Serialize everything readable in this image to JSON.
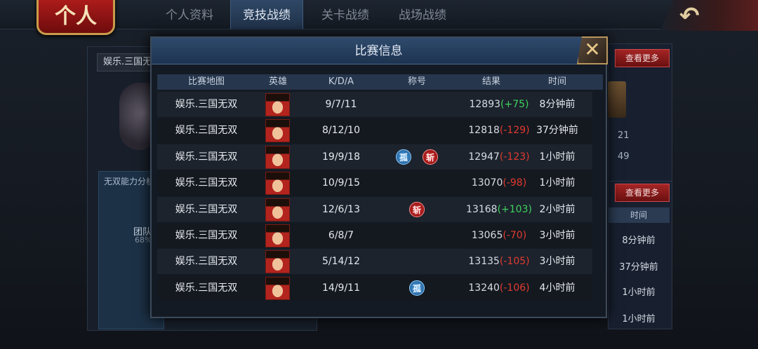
{
  "header": {
    "logo": "个人",
    "tabs": [
      {
        "label": "个人资料"
      },
      {
        "label": "竞技战绩"
      },
      {
        "label": "关卡战绩"
      },
      {
        "label": "战场战绩"
      }
    ]
  },
  "background": {
    "left": {
      "mode_label": "娱乐.三国无双",
      "ability_title": "无双能力分析",
      "team_label": "团队",
      "team_pct": "68%"
    },
    "right": {
      "more1": "查看更多",
      "more2": "查看更多",
      "stat1": "21",
      "stat2": "49",
      "time_header": "时间",
      "times": [
        "8分钟前",
        "37分钟前",
        "1小时前",
        "1小时前"
      ]
    }
  },
  "modal": {
    "title": "比赛信息",
    "columns": [
      "比赛地图",
      "英雄",
      "K/D/A",
      "称号",
      "结果",
      "时间"
    ],
    "rows": [
      {
        "map": "娱乐.三国无双",
        "kda": "9/7/11",
        "titles": [],
        "score": "12893",
        "delta": "(+75)",
        "delta_sign": "pos",
        "time": "8分钟前"
      },
      {
        "map": "娱乐.三国无双",
        "kda": "8/12/10",
        "titles": [],
        "score": "12818",
        "delta": "(-129)",
        "delta_sign": "neg",
        "time": "37分钟前"
      },
      {
        "map": "娱乐.三国无双",
        "kda": "19/9/18",
        "titles": [
          "孤",
          "斩"
        ],
        "score": "12947",
        "delta": "(-123)",
        "delta_sign": "neg",
        "time": "1小时前"
      },
      {
        "map": "娱乐.三国无双",
        "kda": "10/9/15",
        "titles": [],
        "score": "13070",
        "delta": "(-98)",
        "delta_sign": "neg",
        "time": "1小时前"
      },
      {
        "map": "娱乐.三国无双",
        "kda": "12/6/13",
        "titles": [
          "斩"
        ],
        "score": "13168",
        "delta": "(+103)",
        "delta_sign": "pos",
        "time": "2小时前"
      },
      {
        "map": "娱乐.三国无双",
        "kda": "6/8/7",
        "titles": [],
        "score": "13065",
        "delta": "(-70)",
        "delta_sign": "neg",
        "time": "3小时前"
      },
      {
        "map": "娱乐.三国无双",
        "kda": "5/14/12",
        "titles": [],
        "score": "13135",
        "delta": "(-105)",
        "delta_sign": "neg",
        "time": "3小时前"
      },
      {
        "map": "娱乐.三国无双",
        "kda": "14/9/11",
        "titles": [
          "孤"
        ],
        "score": "13240",
        "delta": "(-106)",
        "delta_sign": "neg",
        "time": "4小时前"
      }
    ]
  },
  "colors": {
    "positive": "#3fd25c",
    "negative": "#e23a2e",
    "accent": "#2e4a6c"
  }
}
